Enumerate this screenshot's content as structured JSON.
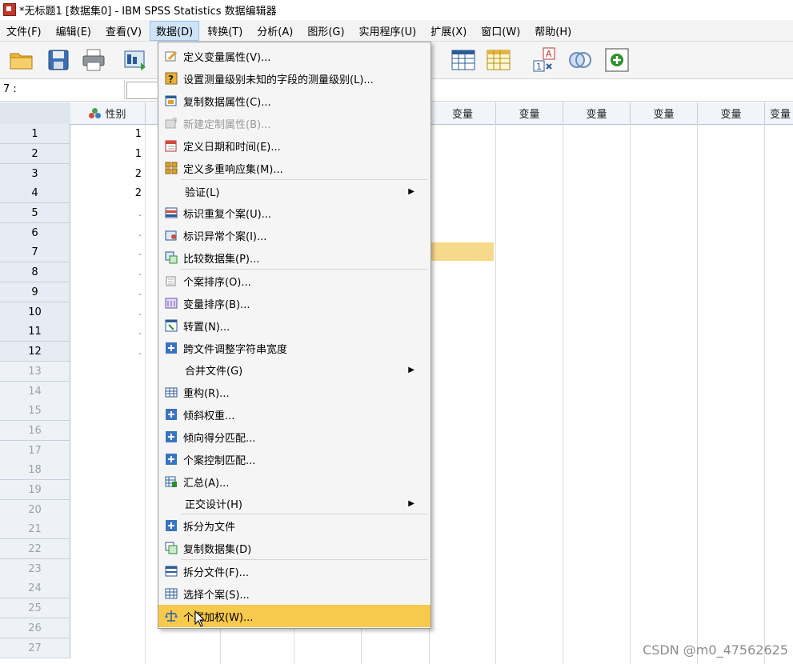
{
  "window": {
    "title": "*无标题1 [数据集0] - IBM SPSS Statistics 数据编辑器"
  },
  "menubar": {
    "items": [
      "文件(F)",
      "编辑(E)",
      "查看(V)",
      "数据(D)",
      "转换(T)",
      "分析(A)",
      "图形(G)",
      "实用程序(U)",
      "扩展(X)",
      "窗口(W)",
      "帮助(H)"
    ],
    "active_index": 3
  },
  "cell_reference": {
    "label": "7 :"
  },
  "grid": {
    "first_column": {
      "name": "性别"
    },
    "variable_placeholder": "变量",
    "rows": [
      "1",
      "2",
      "3",
      "4",
      "5",
      "6",
      "7",
      "8",
      "9",
      "10",
      "11",
      "12",
      "13",
      "14",
      "15",
      "16",
      "17",
      "18",
      "19",
      "20",
      "21",
      "22",
      "23",
      "24",
      "25",
      "26",
      "27"
    ],
    "gender_values": [
      "1",
      "1",
      "2",
      "2",
      ".",
      ".",
      ".",
      ".",
      ".",
      ".",
      ".",
      "."
    ],
    "highlight_row": 7
  },
  "dropdown": {
    "items": [
      {
        "label": "定义变量属性(V)...",
        "icon": "define-properties-icon"
      },
      {
        "label": "设置测量级别未知的字段的测量级别(L)...",
        "icon": "measure-level-icon"
      },
      {
        "label": "复制数据属性(C)...",
        "icon": "copy-properties-icon"
      },
      {
        "label": "新建定制属性(B)...",
        "icon": "custom-attribute-icon",
        "disabled": true
      },
      {
        "label": "定义日期和时间(E)...",
        "icon": "calendar-icon"
      },
      {
        "label": "定义多重响应集(M)...",
        "icon": "multiple-response-icon"
      },
      {
        "label": "验证(L)",
        "submenu": true
      },
      {
        "label": "标识重复个案(U)...",
        "icon": "duplicate-cases-icon"
      },
      {
        "label": "标识异常个案(I)...",
        "icon": "unusual-cases-icon"
      },
      {
        "label": "比较数据集(P)...",
        "icon": "compare-datasets-icon"
      },
      {
        "label": "个案排序(O)...",
        "icon": "sort-cases-icon"
      },
      {
        "label": "变量排序(B)...",
        "icon": "sort-variables-icon"
      },
      {
        "label": "转置(N)...",
        "icon": "transpose-icon"
      },
      {
        "label": "跨文件调整字符串宽度",
        "icon": "plus-box-icon"
      },
      {
        "label": "合并文件(G)",
        "submenu": true
      },
      {
        "label": "重构(R)...",
        "icon": "restructure-icon"
      },
      {
        "label": "倾斜权重...",
        "icon": "plus-box-icon"
      },
      {
        "label": "倾向得分匹配...",
        "icon": "plus-box-icon"
      },
      {
        "label": "个案控制匹配...",
        "icon": "plus-box-icon"
      },
      {
        "label": "汇总(A)...",
        "icon": "aggregate-icon"
      },
      {
        "label": "正交设计(H)",
        "submenu": true
      },
      {
        "label": "拆分为文件",
        "icon": "plus-box-icon"
      },
      {
        "label": "复制数据集(D)",
        "icon": "copy-dataset-icon"
      },
      {
        "label": "拆分文件(F)...",
        "icon": "split-file-icon"
      },
      {
        "label": "选择个案(S)...",
        "icon": "select-cases-icon"
      },
      {
        "label": "个案加权(W)...",
        "icon": "weight-cases-icon",
        "highlighted": true
      }
    ]
  },
  "watermark": {
    "text": "CSDN @m0_47562625"
  },
  "colors": {
    "highlight": "#f7c94c",
    "selected_cell": "#f6d98a",
    "menu_active": "#cfe3f7"
  }
}
